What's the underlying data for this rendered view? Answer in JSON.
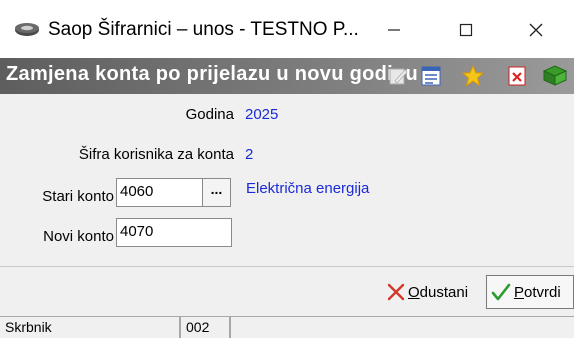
{
  "window": {
    "title": "Saop Šifrarnici – unos - TESTNO P...",
    "icon": "saop-app-icon",
    "controls": {
      "minimize": "minimize-icon",
      "maximize": "maximize-icon",
      "close": "close-icon"
    }
  },
  "header": {
    "title": "Zamjena konta po prijelazu u novu godinu",
    "toolbar_icons": [
      "edit-icon",
      "list-icon",
      "star-icon",
      "delete-icon",
      "book-icon"
    ]
  },
  "form": {
    "godina_label": "Godina",
    "godina_value": "2025",
    "sifra_label": "Šifra korisnika za konta",
    "sifra_value": "2",
    "stari_label": "Stari konto",
    "stari_value": "4060",
    "stari_desc": "Električna energija",
    "lookup_label": "...",
    "novi_label": "Novi konto",
    "novi_value": "4070"
  },
  "buttons": {
    "cancel_mnemonic": "O",
    "cancel_rest": "dustani",
    "ok_mnemonic": "P",
    "ok_rest": "otvrdi"
  },
  "status": {
    "user": "Skrbnik",
    "code": "002",
    "extra": ""
  },
  "colors": {
    "value_blue": "#1a2bd6",
    "banner_gray": "#6e6e6e",
    "cancel_red": "#d23a2a",
    "ok_green": "#2e9a2e"
  }
}
